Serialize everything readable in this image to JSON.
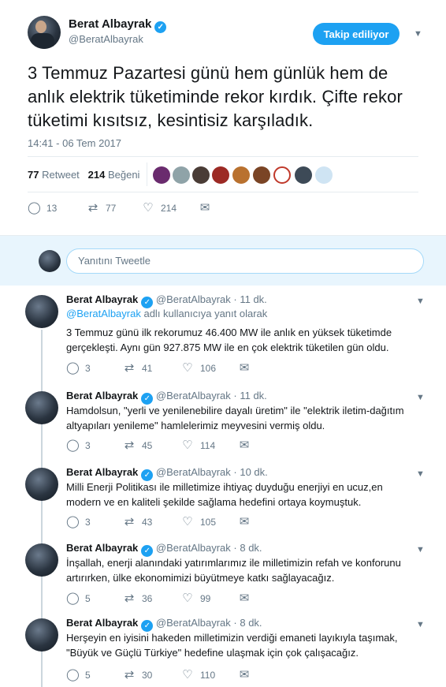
{
  "main": {
    "author_name": "Berat Albayrak",
    "author_handle": "@BeratAlbayrak",
    "follow_label": "Takip ediliyor",
    "text": "3 Temmuz Pazartesi günü hem günlük hem de anlık elektrik tüketiminde rekor kırdık. Çifte rekor tüketimi kısıtsız, kesintisiz karşıladık.",
    "timestamp": "14:41 - 06 Tem 2017",
    "retweet_count": "77",
    "retweet_label": "Retweet",
    "like_count": "214",
    "like_label": "Beğeni",
    "actions": {
      "reply": "13",
      "retweet": "77",
      "like": "214"
    }
  },
  "reply_box": {
    "placeholder": "Yanıtını Tweetle"
  },
  "replies": [
    {
      "name": "Berat Albayrak",
      "handle": "@BeratAlbayrak",
      "time": "· 11 dk.",
      "context_link": "@BeratAlbayrak",
      "context_text": " adlı kullanıcıya yanıt olarak",
      "text": "3 Temmuz günü ilk rekorumuz 46.400 MW ile anlık en yüksek tüketimde gerçekleşti. Aynı gün 927.875 MW ile en çok elektrik tüketilen gün oldu.",
      "reply": "3",
      "retweet": "41",
      "like": "106"
    },
    {
      "name": "Berat Albayrak",
      "handle": "@BeratAlbayrak",
      "time": "· 11 dk.",
      "text": "Hamdolsun, \"yerli ve yenilenebilire dayalı üretim\" ile \"elektrik iletim-dağıtım altyapıları yenileme\" hamlelerimiz meyvesini vermiş oldu.",
      "reply": "3",
      "retweet": "45",
      "like": "114"
    },
    {
      "name": "Berat Albayrak",
      "handle": "@BeratAlbayrak",
      "time": "· 10 dk.",
      "text": "Milli Enerji Politikası ile milletimize ihtiyaç duyduğu enerjiyi en ucuz,en modern ve en kaliteli şekilde sağlama hedefini ortaya koymuştuk.",
      "reply": "3",
      "retweet": "43",
      "like": "105"
    },
    {
      "name": "Berat Albayrak",
      "handle": "@BeratAlbayrak",
      "time": "· 8 dk.",
      "text": "İnşallah, enerji alanındaki yatırımlarımız ile milletimizin refah ve konforunu artırırken, ülke ekonomimizi büyütmeye katkı sağlayacağız.",
      "reply": "5",
      "retweet": "36",
      "like": "99"
    },
    {
      "name": "Berat Albayrak",
      "handle": "@BeratAlbayrak",
      "time": "· 8 dk.",
      "text": "Herşeyin en iyisini hakeden milletimizin verdiği emaneti layıkıyla taşımak, \"Büyük ve Güçlü Türkiye\" hedefine ulaşmak için çok çalışacağız.",
      "reply": "5",
      "retweet": "30",
      "like": "110"
    }
  ],
  "colors": {
    "accent": "#1da1f2",
    "muted": "#657786",
    "reply_bg": "#e8f5fd"
  },
  "icons": {
    "reply": "reply-icon",
    "retweet": "retweet-icon",
    "like": "heart-icon",
    "dm": "envelope-icon",
    "verified": "verified-badge-icon",
    "caret": "chevron-down-icon"
  }
}
